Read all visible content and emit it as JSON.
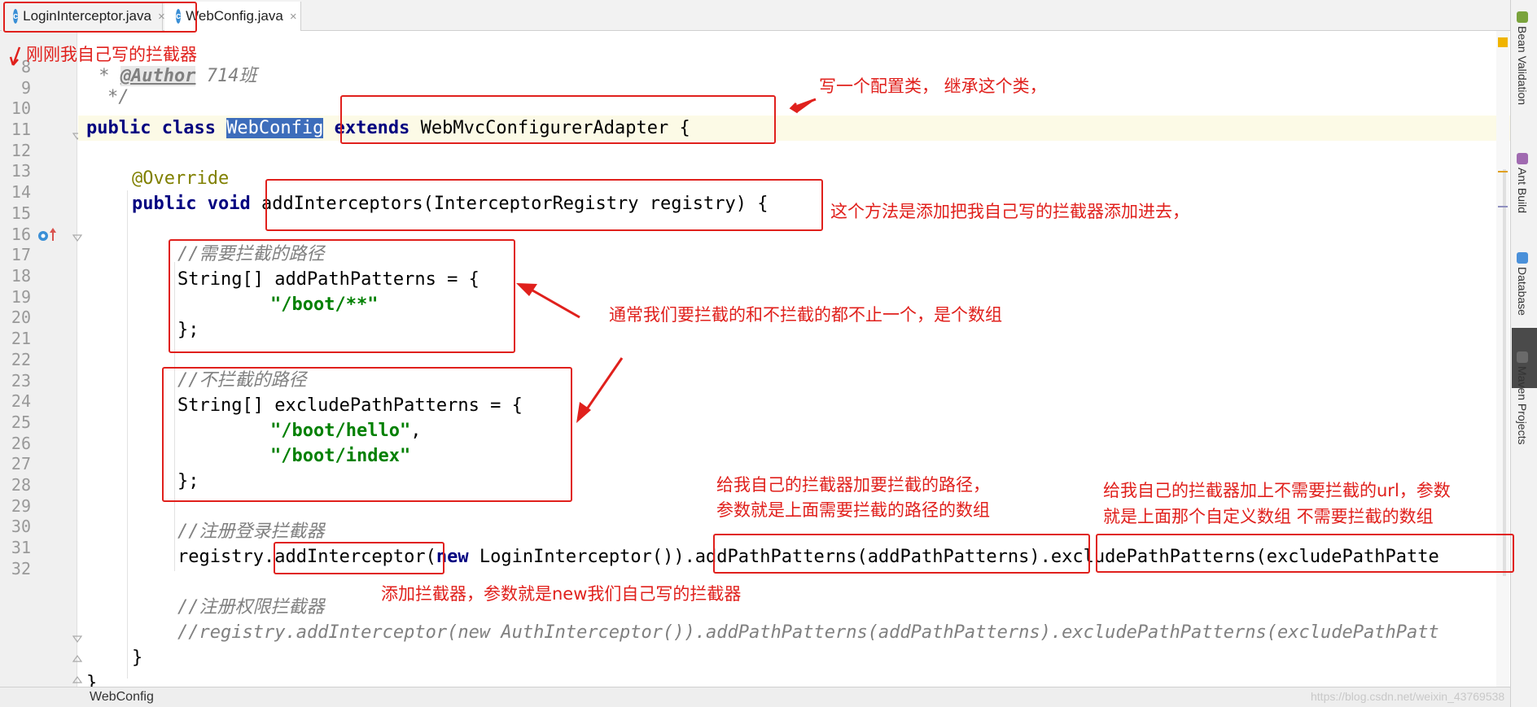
{
  "tabs": [
    {
      "label": "LoginInterceptor.java",
      "icon": "java-class-icon",
      "close": "×",
      "active": false
    },
    {
      "label": "WebConfig.java",
      "icon": "java-class-icon",
      "close": "×",
      "active": true
    }
  ],
  "tab_icon_letter": "c",
  "line_numbers": [
    "8",
    "9",
    "10",
    "11",
    "12",
    "13",
    "14",
    "15",
    "16",
    "17",
    "18",
    "19",
    "20",
    "21",
    "22",
    "23",
    "24",
    "25",
    "26",
    "27",
    "28",
    "29",
    "30",
    "31",
    "32"
  ],
  "code": {
    "l8": {
      "prefix": " * ",
      "tag": "@Author",
      "rest": " 714班"
    },
    "l9": {
      "text": "*/"
    },
    "l10": {
      "kw1": "public class ",
      "selected": "WebConfig",
      "kw2": " extends",
      "rest": " WebMvcConfigurerAdapter {"
    },
    "l12": {
      "annotation": "@Override"
    },
    "l13": {
      "kw": "public void",
      "rest": " addInterceptors(InterceptorRegistry registry) {"
    },
    "l15": {
      "comment": "//需要拦截的路径"
    },
    "l16": {
      "text": "String[] addPathPatterns = {"
    },
    "l17": {
      "str": "\"/boot/**\""
    },
    "l18": {
      "text": "};"
    },
    "l20": {
      "comment": "//不拦截的路径"
    },
    "l21": {
      "text": "String[] excludePathPatterns = {"
    },
    "l22": {
      "str": "\"/boot/hello\"",
      "punct": ","
    },
    "l23": {
      "str": "\"/boot/index\""
    },
    "l24": {
      "text": "};"
    },
    "l26": {
      "comment": "//注册登录拦截器"
    },
    "l27": {
      "a": "registry",
      "b": ".addInterceptor",
      "c": "(",
      "kw": "new",
      "d": " LoginInterceptor())",
      "e": ".addPathPatterns(addPathPatterns)",
      "f": ".excludePathPatterns(excludePathPatte"
    },
    "l29": {
      "comment": "//注册权限拦截器"
    },
    "l30": {
      "comment": "//registry.addInterceptor(new AuthInterceptor()).addPathPatterns(addPathPatterns).excludePathPatterns(excludePathPatt"
    },
    "l31": {
      "text": "}"
    },
    "l32": {
      "text": "}"
    }
  },
  "annotations": {
    "n1": "刚刚我自己写的拦截器",
    "n2": "写一个配置类， 继承这个类，",
    "n3": "这个方法是添加把我自己写的拦截器添加进去，",
    "n4": "通常我们要拦截的和不拦截的都不止一个，是个数组",
    "n5a": "给我自己的拦截器加要拦截的路径，",
    "n5b": "参数就是上面需要拦截的路径的数组",
    "n6a": "给我自己的拦截器加上不需要拦截的url，参数",
    "n6b": "就是上面那个自定义数组 不需要拦截的数组",
    "n7": "添加拦截器，参数就是new我们自己写的拦截器"
  },
  "statusbar": {
    "breadcrumb": "WebConfig",
    "watermark": "https://blog.csdn.net/weixin_43769538"
  },
  "right_tools": [
    "Bean Validation",
    "Ant Build",
    "Database",
    "Maven Projects"
  ],
  "colors": {
    "annotation_red": "#e0201c",
    "selection": "#3d6dbb",
    "keyword": "#000080",
    "string": "#008000",
    "current_line": "#fcfae6"
  }
}
